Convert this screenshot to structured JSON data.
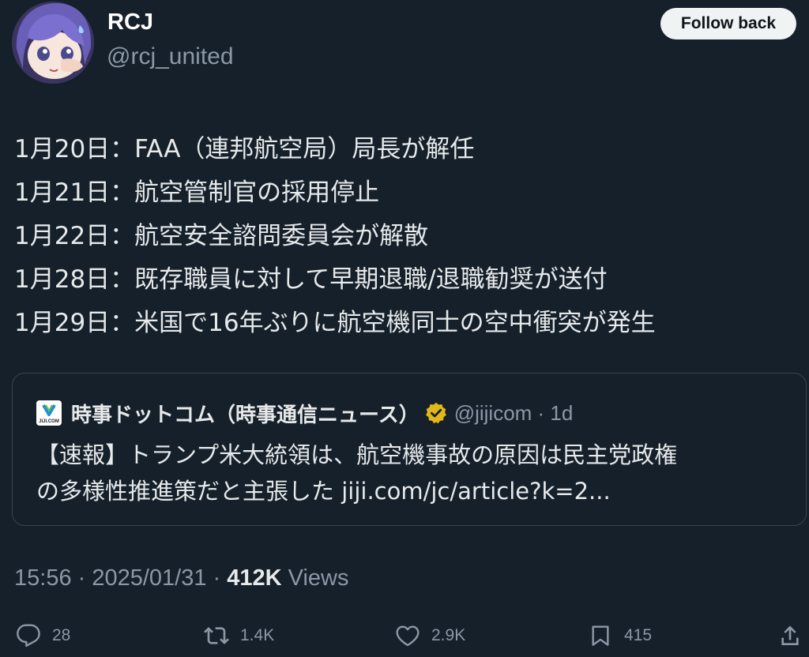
{
  "author": {
    "display_name": "RCJ",
    "handle": "@rcj_united"
  },
  "follow_button": {
    "label": "Follow back"
  },
  "tweet": {
    "lines": [
      "1月20日：FAA（連邦航空局）局長が解任",
      "1月21日：航空管制官の採用停止",
      "1月22日：航空安全諮問委員会が解散",
      "1月28日：既存職員に対して早期退職/退職勧奨が送付",
      "1月29日：米国で16年ぶりに航空機同士の空中衝突が発生"
    ]
  },
  "quote": {
    "logo_text": "JIJI.COM",
    "author_name": "時事ドットコム（時事通信ニュース）",
    "verified_icon": "verified-badge-gold",
    "author_handle_time": "@jijicom · 1d",
    "lines": [
      "【速報】トランプ米大統領は、航空機事故の原因は民主党政権",
      "の多様性推進策だと主張した jiji.com/jc/article?k=2..."
    ]
  },
  "meta": {
    "time": "15:56 · 2025/01/31 · ",
    "views_count": "412K",
    "views_label": " Views"
  },
  "actions": {
    "replies": "28",
    "reposts": "1.4K",
    "likes": "2.9K",
    "bookmarks": "415"
  },
  "icons": {
    "reply": "reply-icon",
    "repost": "repost-icon",
    "like": "heart-icon",
    "bookmark": "bookmark-icon",
    "share": "share-icon"
  },
  "colors": {
    "background": "#15202b",
    "text": "#e7e9ea",
    "muted": "#8b98a5",
    "border": "#38444d",
    "verified_gold": "#e2b719"
  }
}
